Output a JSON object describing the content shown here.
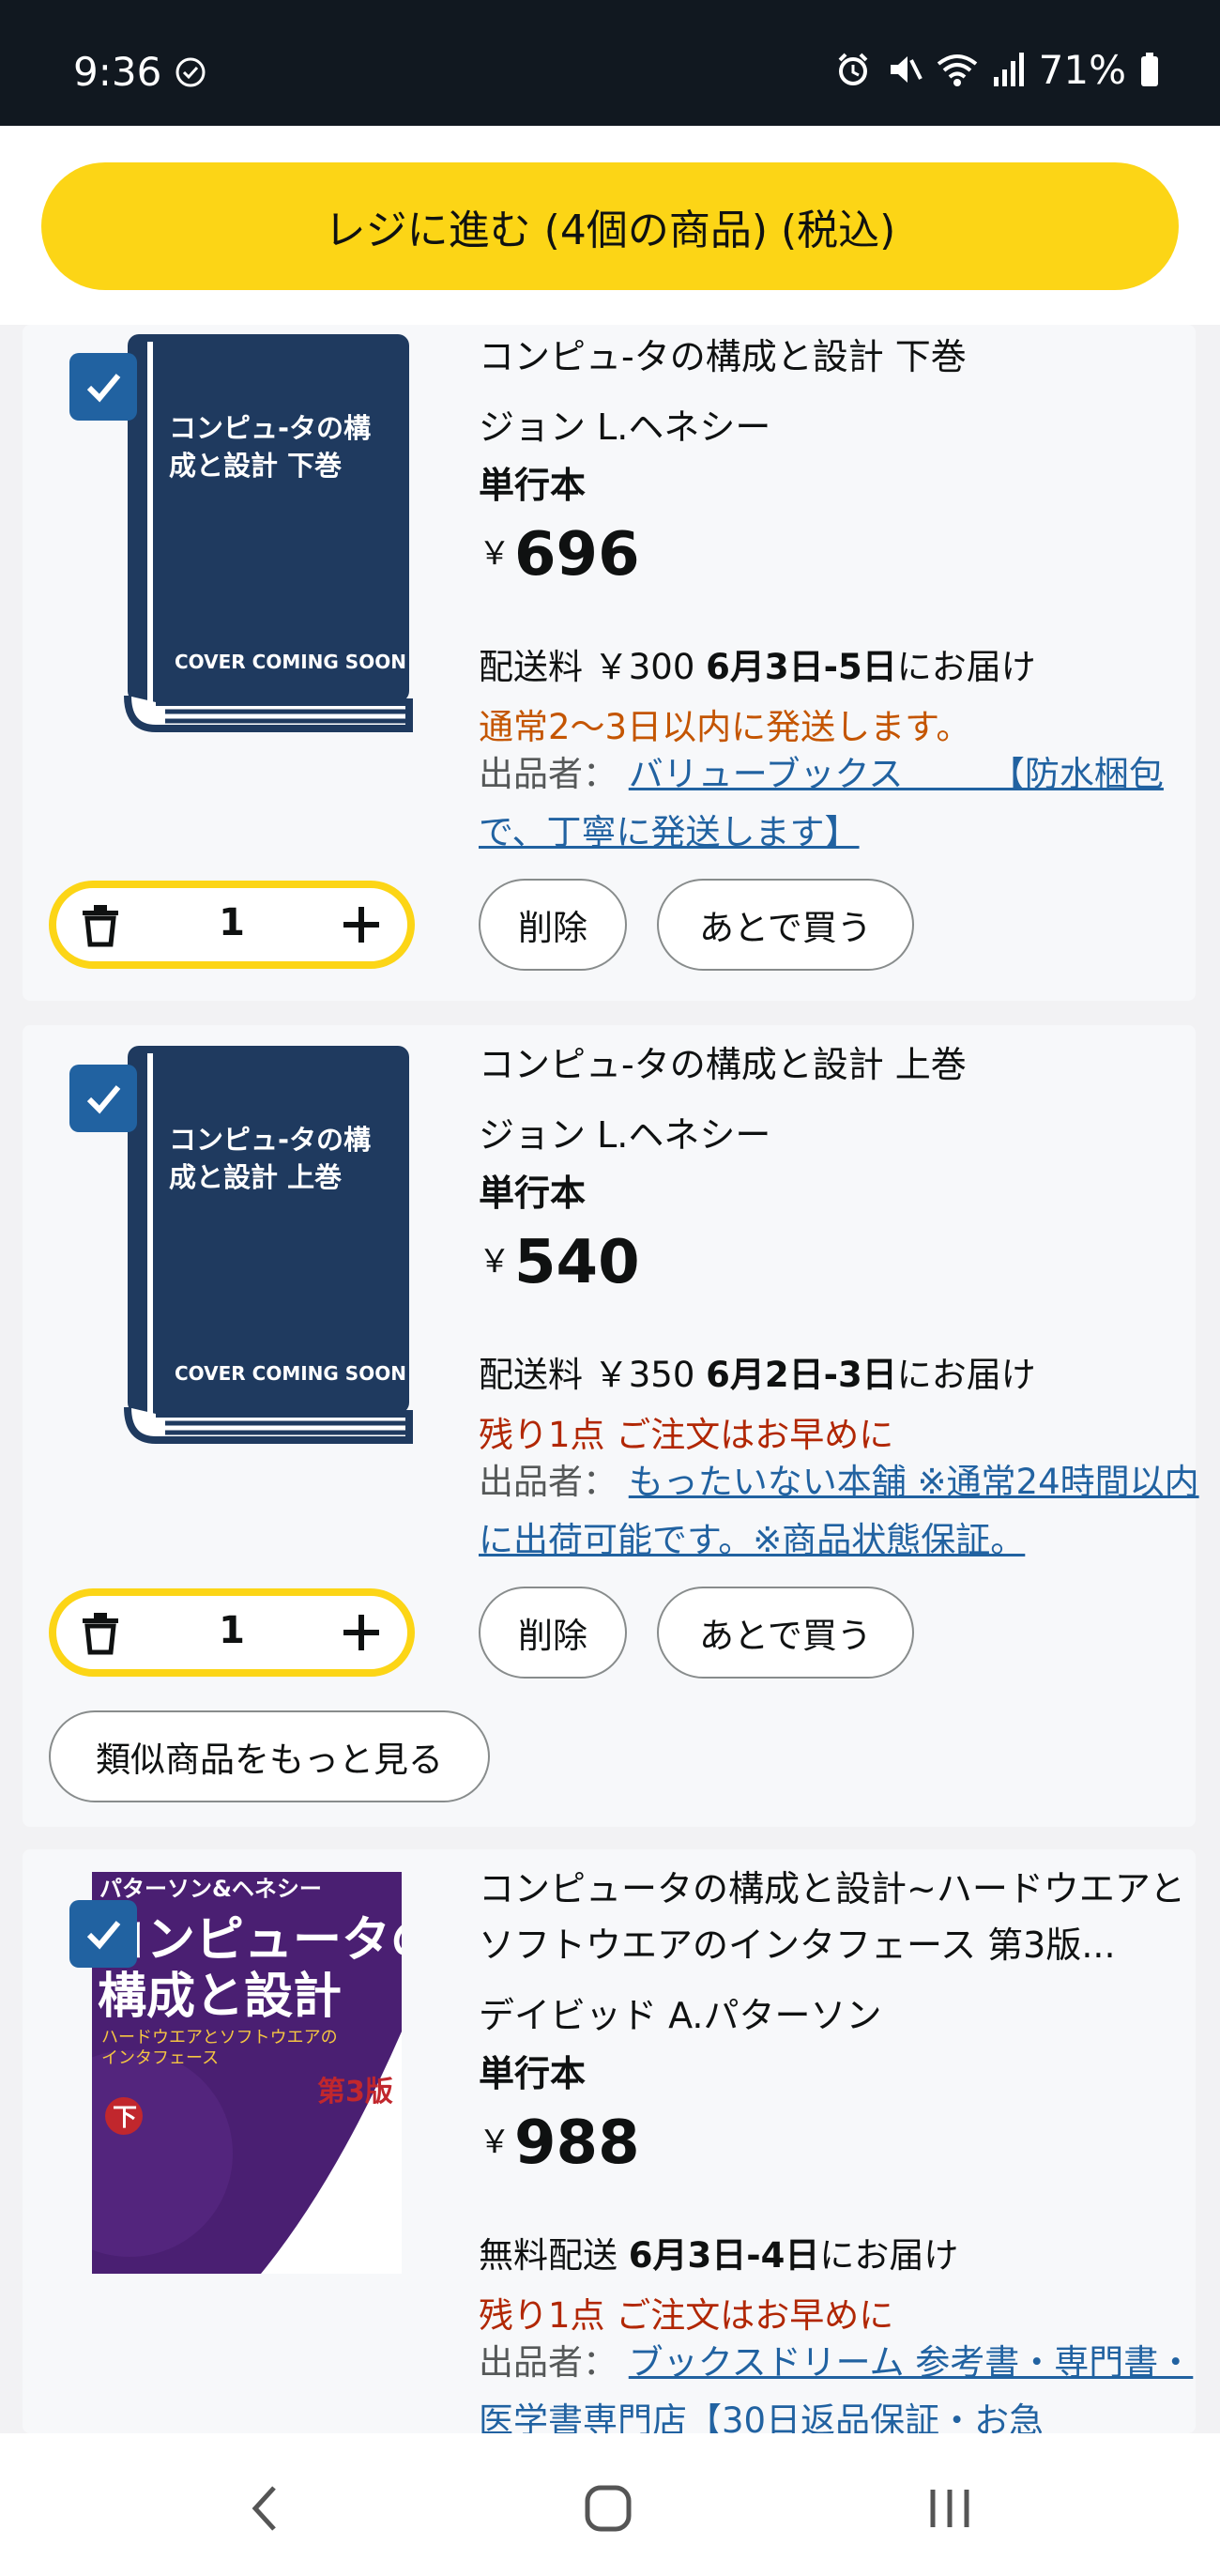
{
  "status_bar": {
    "time": "9:36",
    "battery": "71%"
  },
  "checkout_button": "レジに進む (4個の商品) (税込)",
  "items": [
    {
      "cover_title": "コンピュータの構成と設計 下巻",
      "cover_note": "COVER COMING SOON",
      "title": "コンピュ-タの構成と設計 下巻",
      "author": "ジョン L.ヘネシー",
      "format": "単行本",
      "currency": "￥",
      "price": "696",
      "ship_prefix": "配送料 ￥300 ",
      "ship_date": "6月3日-5日",
      "ship_suffix": "にお届け",
      "availability": "通常2～3日以内に発送します。",
      "availability_color": "#c45500",
      "seller_label": "出品者：",
      "seller_name": "バリューブックス　　　【防水梱包で、丁寧に発送します】",
      "quantity": "1",
      "delete_label": "削除",
      "save_label": "あとで買う"
    },
    {
      "cover_title": "コンピュ-タの構成と設計 上巻",
      "cover_note": "COVER COMING SOON",
      "title": "コンピュ-タの構成と設計 上巻",
      "author": "ジョン L.ヘネシー",
      "format": "単行本",
      "currency": "￥",
      "price": "540",
      "ship_prefix": "配送料 ￥350 ",
      "ship_date": "6月2日-3日",
      "ship_suffix": "にお届け",
      "availability": "残り1点 ご注文はお早めに",
      "availability_color": "#b12704",
      "seller_label": "出品者：",
      "seller_name": "もったいない本舗 ※通常24時間以内に出荷可能です。※商品状態保証。",
      "quantity": "1",
      "delete_label": "削除",
      "save_label": "あとで買う",
      "similar_label": "類似商品をもっと見る"
    },
    {
      "cover_author_line": "パターソン&ヘネシー",
      "cover_title_1": "コンピュータの",
      "cover_title_2": "構成と設計",
      "cover_subtitle": "ハードウエアとソフトウエアのインタフェース",
      "cover_edition": "第3版",
      "cover_volume": "下",
      "title": "コンピュータの構成と設計~ハードウエアとソフトウエアのインタフェース 第3版...",
      "author": "デイビッド A.パターソン",
      "format": "単行本",
      "currency": "￥",
      "price": "988",
      "ship_prefix": "無料配送 ",
      "ship_date": "6月3日-4日",
      "ship_suffix": "にお届け",
      "availability": "残り1点 ご注文はお早めに",
      "availability_color": "#b12704",
      "seller_label": "出品者：",
      "seller_name": "ブックスドリーム 参考書・専門書・医学書専門店【30日返品保証・お急"
    }
  ],
  "colors": {
    "accent": "#fcd516",
    "link": "#2162a1",
    "book_cover": "#1f3a5f"
  }
}
